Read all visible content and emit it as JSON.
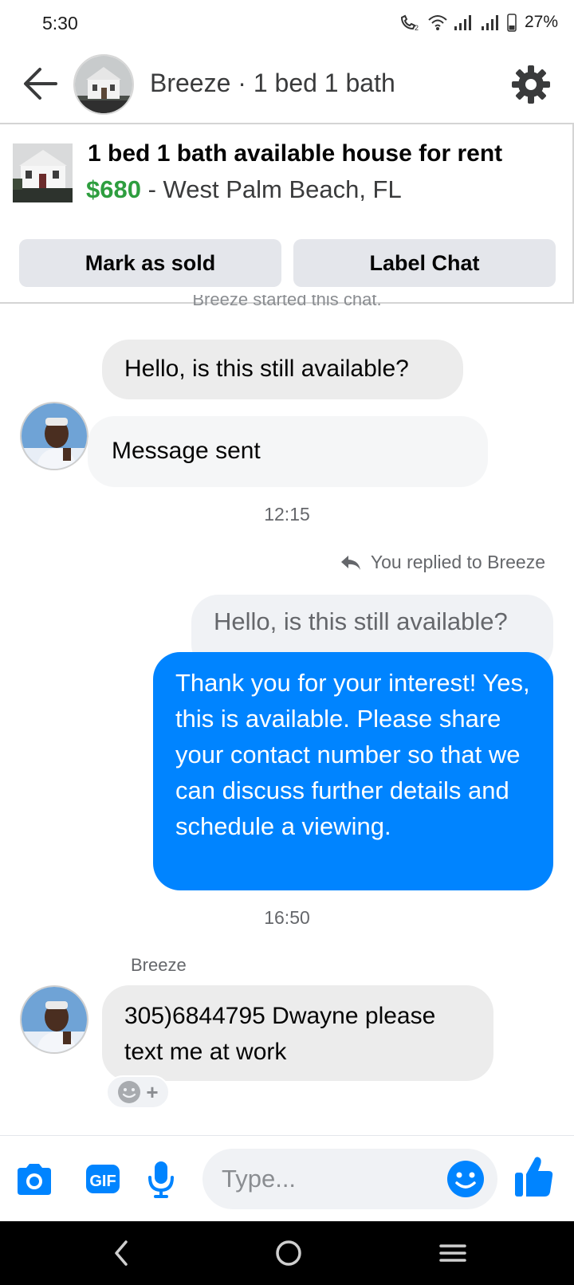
{
  "status_bar": {
    "time": "5:30",
    "battery": "27%"
  },
  "header": {
    "title": "Breeze · 1 bed 1 bath"
  },
  "listing": {
    "title": "1 bed 1 bath available house for rent",
    "price": "$680",
    "separator": " - ",
    "location": "West Palm Beach, FL",
    "mark_sold_label": "Mark as sold",
    "label_chat_label": "Label Chat"
  },
  "chat": {
    "started_text": "Breeze started this chat.",
    "messages_in_1": "Hello, is this still available?",
    "messages_in_2": "Message sent",
    "timestamp_1": "12:15",
    "replied_text": "You replied to Breeze",
    "quoted_text": "Hello, is this still available?",
    "reply_text": "Thank you for your interest! Yes, this is available. Please share your contact number so that we can discuss further details and schedule a viewing.",
    "timestamp_2": "16:50",
    "sender_name": "Breeze",
    "messages_in_3": "305)6844795 Dwayne please text me at work"
  },
  "composer": {
    "placeholder": "Type..."
  },
  "colors": {
    "accent": "#0084ff",
    "price": "#2e9e3f",
    "bubble_in": "#f0f2f5"
  },
  "icons": [
    "back-arrow-icon",
    "gear-icon",
    "camera-icon",
    "gif-icon",
    "microphone-icon",
    "emoji-icon",
    "thumbs-up-icon",
    "reply-arrow-icon",
    "smiley-react-icon"
  ]
}
